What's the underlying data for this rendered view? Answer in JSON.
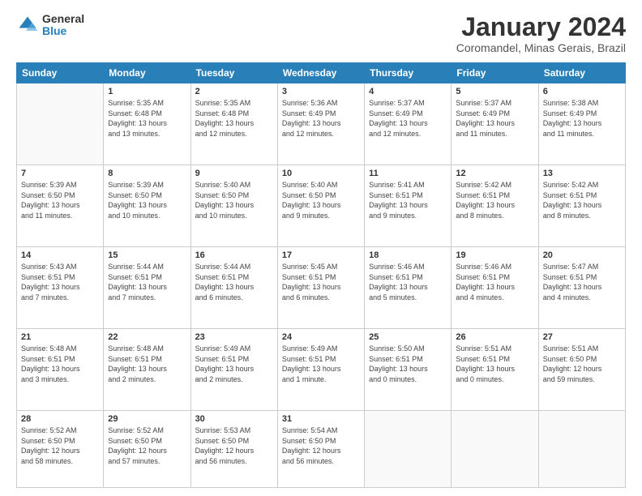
{
  "logo": {
    "general": "General",
    "blue": "Blue"
  },
  "title": "January 2024",
  "subtitle": "Coromandel, Minas Gerais, Brazil",
  "headers": [
    "Sunday",
    "Monday",
    "Tuesday",
    "Wednesday",
    "Thursday",
    "Friday",
    "Saturday"
  ],
  "weeks": [
    [
      {
        "date": "",
        "info": ""
      },
      {
        "date": "1",
        "info": "Sunrise: 5:35 AM\nSunset: 6:48 PM\nDaylight: 13 hours\nand 13 minutes."
      },
      {
        "date": "2",
        "info": "Sunrise: 5:35 AM\nSunset: 6:48 PM\nDaylight: 13 hours\nand 12 minutes."
      },
      {
        "date": "3",
        "info": "Sunrise: 5:36 AM\nSunset: 6:49 PM\nDaylight: 13 hours\nand 12 minutes."
      },
      {
        "date": "4",
        "info": "Sunrise: 5:37 AM\nSunset: 6:49 PM\nDaylight: 13 hours\nand 12 minutes."
      },
      {
        "date": "5",
        "info": "Sunrise: 5:37 AM\nSunset: 6:49 PM\nDaylight: 13 hours\nand 11 minutes."
      },
      {
        "date": "6",
        "info": "Sunrise: 5:38 AM\nSunset: 6:49 PM\nDaylight: 13 hours\nand 11 minutes."
      }
    ],
    [
      {
        "date": "7",
        "info": "Sunrise: 5:39 AM\nSunset: 6:50 PM\nDaylight: 13 hours\nand 11 minutes."
      },
      {
        "date": "8",
        "info": "Sunrise: 5:39 AM\nSunset: 6:50 PM\nDaylight: 13 hours\nand 10 minutes."
      },
      {
        "date": "9",
        "info": "Sunrise: 5:40 AM\nSunset: 6:50 PM\nDaylight: 13 hours\nand 10 minutes."
      },
      {
        "date": "10",
        "info": "Sunrise: 5:40 AM\nSunset: 6:50 PM\nDaylight: 13 hours\nand 9 minutes."
      },
      {
        "date": "11",
        "info": "Sunrise: 5:41 AM\nSunset: 6:51 PM\nDaylight: 13 hours\nand 9 minutes."
      },
      {
        "date": "12",
        "info": "Sunrise: 5:42 AM\nSunset: 6:51 PM\nDaylight: 13 hours\nand 8 minutes."
      },
      {
        "date": "13",
        "info": "Sunrise: 5:42 AM\nSunset: 6:51 PM\nDaylight: 13 hours\nand 8 minutes."
      }
    ],
    [
      {
        "date": "14",
        "info": "Sunrise: 5:43 AM\nSunset: 6:51 PM\nDaylight: 13 hours\nand 7 minutes."
      },
      {
        "date": "15",
        "info": "Sunrise: 5:44 AM\nSunset: 6:51 PM\nDaylight: 13 hours\nand 7 minutes."
      },
      {
        "date": "16",
        "info": "Sunrise: 5:44 AM\nSunset: 6:51 PM\nDaylight: 13 hours\nand 6 minutes."
      },
      {
        "date": "17",
        "info": "Sunrise: 5:45 AM\nSunset: 6:51 PM\nDaylight: 13 hours\nand 6 minutes."
      },
      {
        "date": "18",
        "info": "Sunrise: 5:46 AM\nSunset: 6:51 PM\nDaylight: 13 hours\nand 5 minutes."
      },
      {
        "date": "19",
        "info": "Sunrise: 5:46 AM\nSunset: 6:51 PM\nDaylight: 13 hours\nand 4 minutes."
      },
      {
        "date": "20",
        "info": "Sunrise: 5:47 AM\nSunset: 6:51 PM\nDaylight: 13 hours\nand 4 minutes."
      }
    ],
    [
      {
        "date": "21",
        "info": "Sunrise: 5:48 AM\nSunset: 6:51 PM\nDaylight: 13 hours\nand 3 minutes."
      },
      {
        "date": "22",
        "info": "Sunrise: 5:48 AM\nSunset: 6:51 PM\nDaylight: 13 hours\nand 2 minutes."
      },
      {
        "date": "23",
        "info": "Sunrise: 5:49 AM\nSunset: 6:51 PM\nDaylight: 13 hours\nand 2 minutes."
      },
      {
        "date": "24",
        "info": "Sunrise: 5:49 AM\nSunset: 6:51 PM\nDaylight: 13 hours\nand 1 minute."
      },
      {
        "date": "25",
        "info": "Sunrise: 5:50 AM\nSunset: 6:51 PM\nDaylight: 13 hours\nand 0 minutes."
      },
      {
        "date": "26",
        "info": "Sunrise: 5:51 AM\nSunset: 6:51 PM\nDaylight: 13 hours\nand 0 minutes."
      },
      {
        "date": "27",
        "info": "Sunrise: 5:51 AM\nSunset: 6:50 PM\nDaylight: 12 hours\nand 59 minutes."
      }
    ],
    [
      {
        "date": "28",
        "info": "Sunrise: 5:52 AM\nSunset: 6:50 PM\nDaylight: 12 hours\nand 58 minutes."
      },
      {
        "date": "29",
        "info": "Sunrise: 5:52 AM\nSunset: 6:50 PM\nDaylight: 12 hours\nand 57 minutes."
      },
      {
        "date": "30",
        "info": "Sunrise: 5:53 AM\nSunset: 6:50 PM\nDaylight: 12 hours\nand 56 minutes."
      },
      {
        "date": "31",
        "info": "Sunrise: 5:54 AM\nSunset: 6:50 PM\nDaylight: 12 hours\nand 56 minutes."
      },
      {
        "date": "",
        "info": ""
      },
      {
        "date": "",
        "info": ""
      },
      {
        "date": "",
        "info": ""
      }
    ]
  ]
}
